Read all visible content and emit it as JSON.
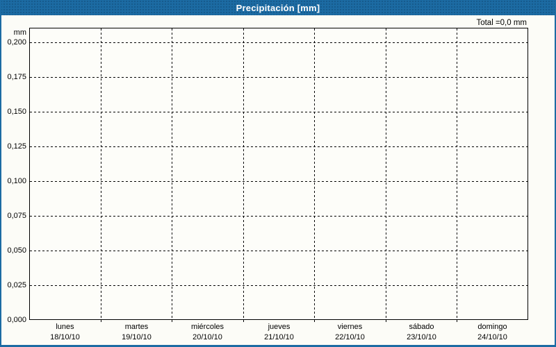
{
  "header": {
    "title": "Precipitación [mm]",
    "total": "Total =0,0 mm"
  },
  "y_axis": {
    "unit_label": "mm",
    "ticks": [
      {
        "value": 0.2,
        "label": "0,200"
      },
      {
        "value": 0.175,
        "label": "0,175"
      },
      {
        "value": 0.15,
        "label": "0,150"
      },
      {
        "value": 0.125,
        "label": "0,125"
      },
      {
        "value": 0.1,
        "label": "0,100"
      },
      {
        "value": 0.075,
        "label": "0,075"
      },
      {
        "value": 0.05,
        "label": "0,050"
      },
      {
        "value": 0.025,
        "label": "0,025"
      },
      {
        "value": 0.0,
        "label": "0,000"
      }
    ]
  },
  "x_axis": {
    "days": [
      {
        "name": "lunes",
        "date": "18/10/10"
      },
      {
        "name": "martes",
        "date": "19/10/10"
      },
      {
        "name": "miércoles",
        "date": "20/10/10"
      },
      {
        "name": "jueves",
        "date": "21/10/10"
      },
      {
        "name": "viernes",
        "date": "22/10/10"
      },
      {
        "name": "sábado",
        "date": "23/10/10"
      },
      {
        "name": "domingo",
        "date": "24/10/10"
      }
    ]
  },
  "colors": {
    "header_bg": "#1c6ba3",
    "frame_border": "#1c6ba3",
    "grid": "#000000",
    "title_text": "#ffffff",
    "label_text": "#000000",
    "bar": "#1c6ba3"
  },
  "chart_data": {
    "type": "bar",
    "title": "Precipitación [mm]",
    "ylabel": "mm",
    "xlabel": "",
    "categories": [
      "lunes 18/10/10",
      "martes 19/10/10",
      "miércoles 20/10/10",
      "jueves 21/10/10",
      "viernes 22/10/10",
      "sábado 23/10/10",
      "domingo 24/10/10"
    ],
    "values": [
      0,
      0,
      0,
      0,
      0,
      0,
      0
    ],
    "total_label": "Total =0,0 mm",
    "ylim": [
      0,
      0.2105
    ],
    "yticks": [
      0,
      0.025,
      0.05,
      0.075,
      0.1,
      0.125,
      0.15,
      0.175,
      0.2
    ],
    "grid": true,
    "legend_position": "none"
  }
}
